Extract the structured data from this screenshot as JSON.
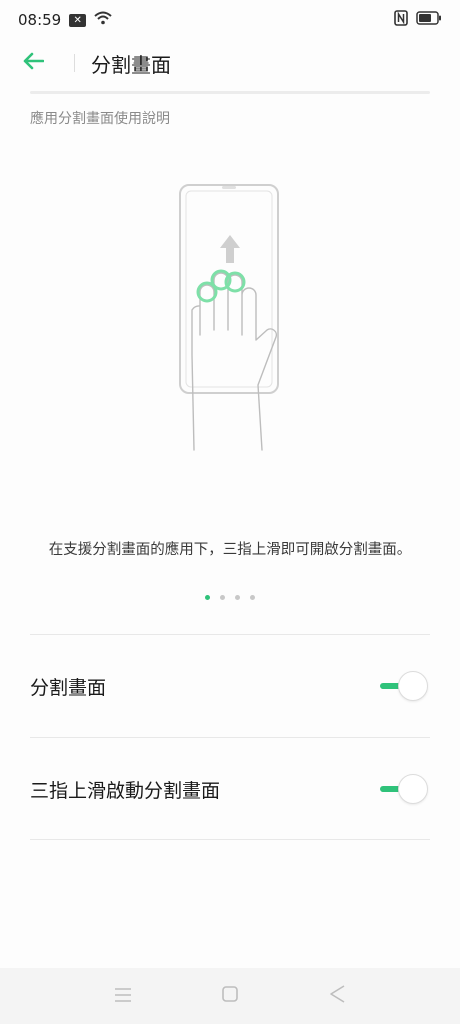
{
  "status_bar": {
    "time": "08:59",
    "icons": [
      "notification-x-icon",
      "wifi-icon",
      "nfc-icon",
      "battery-icon"
    ]
  },
  "header": {
    "title": "分割畫面",
    "back_icon": "back-arrow-icon"
  },
  "intro": {
    "caption": "應用分割畫面使用說明",
    "description": "在支援分割畫面的應用下，三指上滑即可開啟分割畫面。",
    "pages": 4,
    "active_page": 1
  },
  "settings": [
    {
      "label": "分割畫面",
      "enabled": true
    },
    {
      "label": "三指上滑啟動分割畫面",
      "enabled": true
    }
  ],
  "colors": {
    "accent": "#2fc27a",
    "text": "#1a1a1a",
    "caption": "#8a8a8a"
  },
  "nav_bar": [
    "menu-icon",
    "home-icon",
    "back-icon"
  ]
}
